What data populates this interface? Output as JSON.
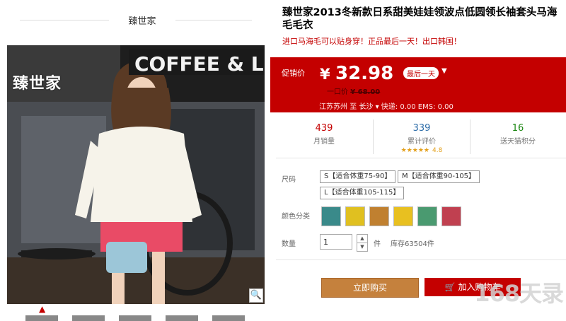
{
  "shop": {
    "name": "臻世家",
    "photo_logo": "臻世家"
  },
  "photo": {
    "sign_text": "COFFEE & LIG"
  },
  "product": {
    "title": "臻世家2013冬新款日系甜美娃娃领波点低圆领长袖套头马海毛毛衣",
    "subtitle": "进口马海毛可以贴身穿！正品最后一天！出口韩国！"
  },
  "price": {
    "label": "促销价",
    "currency": "¥",
    "amount": "32.98",
    "tag": "最后一天",
    "original_label": "一口价",
    "original_value": "¥ 68.00",
    "ship_from": "江苏苏州",
    "ship_to_word": "至",
    "ship_to": "长沙",
    "ship_fee": "快递: 0.00 EMS: 0.00"
  },
  "stats": [
    {
      "value": "439",
      "label": "月销量"
    },
    {
      "value": "339",
      "label": "累计评价",
      "rating": "4.8"
    },
    {
      "value": "16",
      "label": "送天猫积分"
    }
  ],
  "options": {
    "size_label": "尺码",
    "sizes": [
      "S【适合体重75-90】",
      "M【适合体重90-105】",
      "L【适合体重105-115】"
    ],
    "color_label": "颜色分类",
    "colors": [
      "#3a8a8a",
      "#e0c020",
      "#c08030",
      "#e8c020",
      "#4a9a70",
      "#c04050"
    ],
    "qty_label": "数量",
    "qty_value": "1",
    "qty_unit": "件",
    "stock": "库存63504件"
  },
  "actions": {
    "buy": "立即购买",
    "cart": "加入购物车"
  },
  "watermark": "168天录",
  "colors": {
    "accent": "#c40000",
    "buy_button": "#c5813d"
  }
}
